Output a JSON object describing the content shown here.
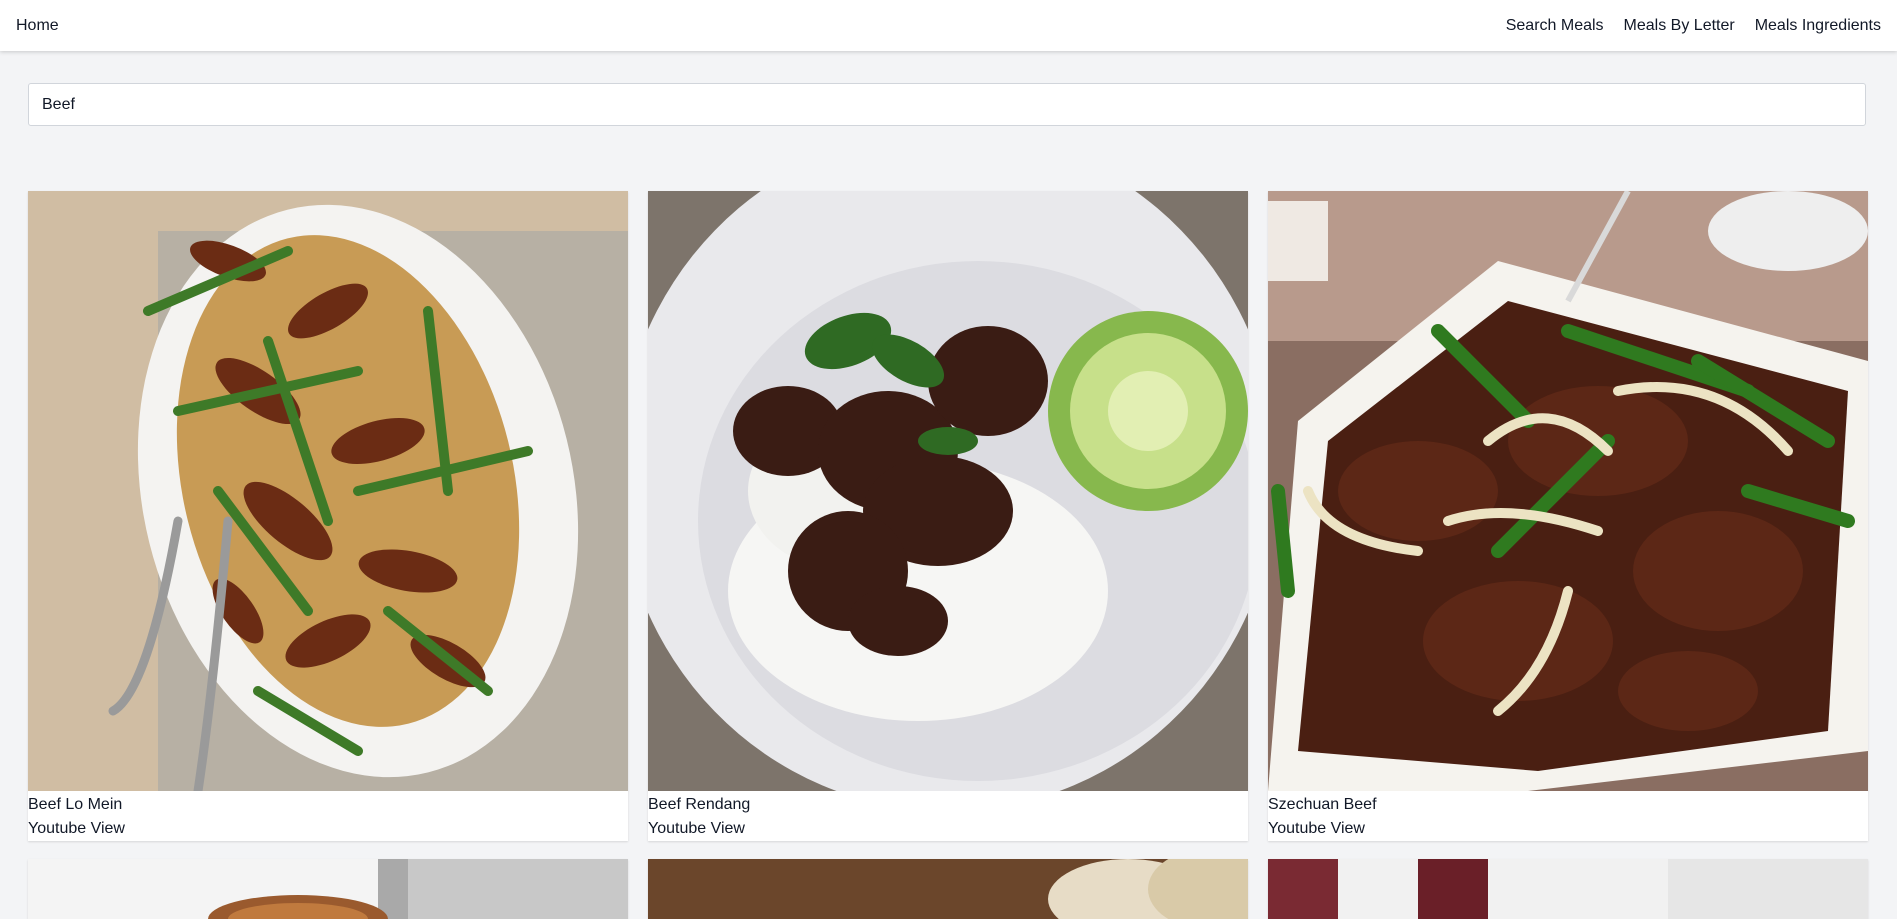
{
  "nav": {
    "home": "Home",
    "links": [
      "Search Meals",
      "Meals By Letter",
      "Meals Ingredients"
    ]
  },
  "search": {
    "value": "Beef"
  },
  "meals": [
    {
      "title": "Beef Lo Mein",
      "link": "Youtube View"
    },
    {
      "title": "Beef Rendang",
      "link": "Youtube View"
    },
    {
      "title": "Szechuan Beef",
      "link": "Youtube View"
    }
  ],
  "colors": {
    "background": "#f3f4f6",
    "surface": "#ffffff",
    "text": "#111827",
    "border": "#d1d5db"
  }
}
